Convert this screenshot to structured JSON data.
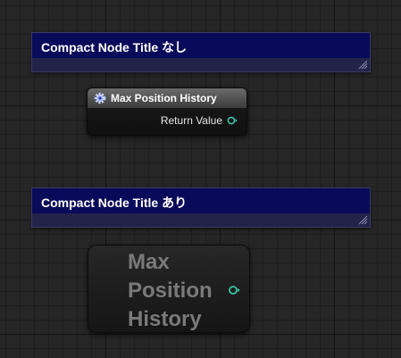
{
  "comments": [
    {
      "title": "Compact Node Title なし"
    },
    {
      "title": "Compact Node Title あり"
    }
  ],
  "node": {
    "title": "Max Position History",
    "header_icon": "function-gear-icon",
    "output_pin": {
      "label": "Return Value",
      "icon": "output-pin-icon"
    }
  },
  "compact_node": {
    "title_line1": "Max",
    "title_line2": "Position",
    "title_line3": "History",
    "output_pin": {
      "icon": "output-pin-icon"
    }
  },
  "colors": {
    "comment_header": "#0a0a5a",
    "comment_body": "#23234a",
    "pin": "#36c6a3",
    "canvas": "#262626"
  }
}
